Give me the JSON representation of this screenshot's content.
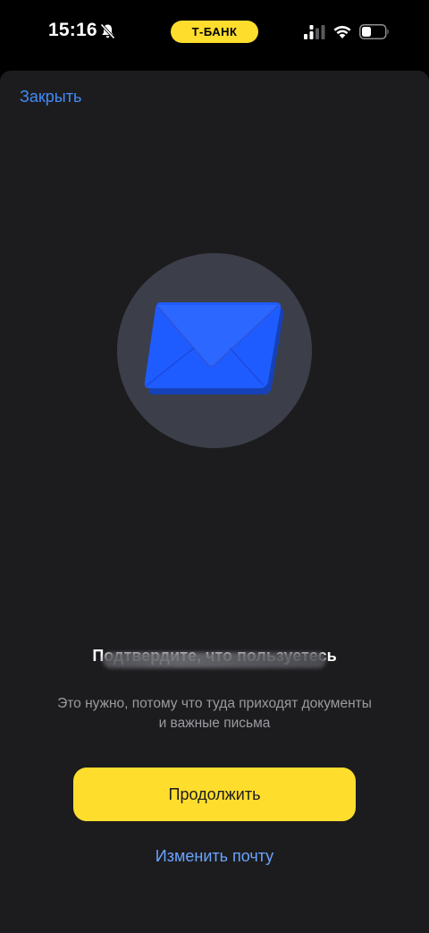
{
  "status_bar": {
    "time": "15:16",
    "carrier": "Т-БАНК",
    "icons": [
      "bell-off-icon",
      "signal-icon",
      "wifi-icon",
      "battery-icon"
    ]
  },
  "sheet": {
    "close_label": "Закрыть",
    "illustration_icon": "envelope-icon",
    "title": "Подтвердите, что пользуетесь",
    "subtitle": "Это нужно, потому что туда приходят документы и важные письма",
    "continue_label": "Продолжить",
    "change_email_label": "Изменить почту"
  },
  "colors": {
    "accent_yellow": "#ffdd2d",
    "link_blue": "#428bf9",
    "sheet_background": "#1c1c1e",
    "envelope_blue": "#1f5cff"
  }
}
